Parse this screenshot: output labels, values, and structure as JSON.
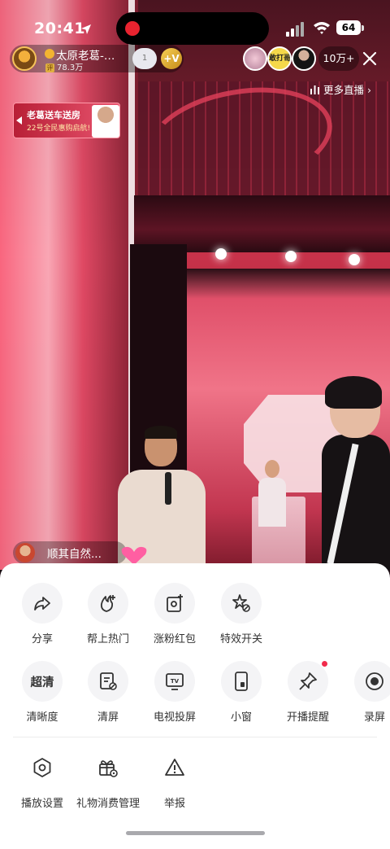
{
  "status_bar": {
    "time": "20:41",
    "battery": "64"
  },
  "streamer": {
    "name": "太原老葛-…",
    "heat": "78.3万",
    "heat_badge": "评",
    "fan_level": "1",
    "follow_label": "+V"
  },
  "viewers": {
    "badge_text": "敢打哥",
    "count": "10万+"
  },
  "more_live": {
    "label": "更多直播 ›"
  },
  "promo": {
    "title": "老葛送车送房",
    "subtitle": "22号全民惠购启航!"
  },
  "comment": {
    "text": "顺其自然..."
  },
  "menu": {
    "row1": [
      {
        "label": "分享",
        "icon": "share-icon"
      },
      {
        "label": "帮上热门",
        "icon": "fire-plus-icon"
      },
      {
        "label": "涨粉红包",
        "icon": "red-packet-icon"
      },
      {
        "label": "特效开关",
        "icon": "effects-icon"
      }
    ],
    "row2": [
      {
        "label": "清晰度",
        "icon_text": "超清"
      },
      {
        "label": "清屏",
        "icon": "clear-screen-icon"
      },
      {
        "label": "电视投屏",
        "icon": "tv-cast-icon",
        "icon_text": "TV"
      },
      {
        "label": "小窗",
        "icon": "mini-window-icon"
      },
      {
        "label": "开播提醒",
        "icon": "pin-reminder-icon"
      },
      {
        "label": "录屏",
        "icon": "record-icon"
      }
    ],
    "row3": [
      {
        "label": "播放设置",
        "icon": "settings-hexagon-icon"
      },
      {
        "label": "礼物消费管理",
        "icon": "gift-management-icon"
      },
      {
        "label": "举报",
        "icon": "report-warning-icon"
      }
    ]
  },
  "colors": {
    "accent_red": "#f12b4c",
    "sheet_bg": "#ffffff",
    "icon_bg": "#f4f4f6"
  }
}
